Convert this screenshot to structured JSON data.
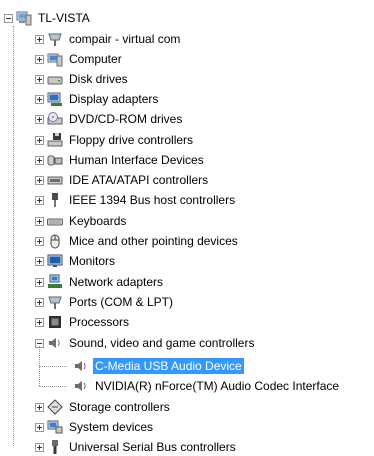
{
  "tree": {
    "root": {
      "label": "TL-VISTA",
      "icon": "computer-icon"
    },
    "categories": [
      {
        "label": "compair - virtual com",
        "icon": "port-icon",
        "expanded": false
      },
      {
        "label": "Computer",
        "icon": "computer-icon",
        "expanded": false
      },
      {
        "label": "Disk drives",
        "icon": "disk-drive-icon",
        "expanded": false
      },
      {
        "label": "Display adapters",
        "icon": "display-adapter-icon",
        "expanded": false
      },
      {
        "label": "DVD/CD-ROM drives",
        "icon": "dvd-drive-icon",
        "expanded": false
      },
      {
        "label": "Floppy drive controllers",
        "icon": "floppy-controller-icon",
        "expanded": false
      },
      {
        "label": "Human Interface Devices",
        "icon": "hid-icon",
        "expanded": false
      },
      {
        "label": "IDE ATA/ATAPI controllers",
        "icon": "ide-controller-icon",
        "expanded": false
      },
      {
        "label": "IEEE 1394 Bus host controllers",
        "icon": "ieee1394-icon",
        "expanded": false
      },
      {
        "label": "Keyboards",
        "icon": "keyboard-icon",
        "expanded": false
      },
      {
        "label": "Mice and other pointing devices",
        "icon": "mouse-icon",
        "expanded": false
      },
      {
        "label": "Monitors",
        "icon": "monitor-icon",
        "expanded": false
      },
      {
        "label": "Network adapters",
        "icon": "network-adapter-icon",
        "expanded": false
      },
      {
        "label": "Ports (COM & LPT)",
        "icon": "port-icon",
        "expanded": false
      },
      {
        "label": "Processors",
        "icon": "processor-icon",
        "expanded": false
      },
      {
        "label": "Sound, video and game controllers",
        "icon": "speaker-icon",
        "expanded": true,
        "children": [
          {
            "label": "C-Media USB Audio Device",
            "icon": "speaker-icon",
            "selected": true
          },
          {
            "label": "NVIDIA(R) nForce(TM) Audio Codec Interface",
            "icon": "speaker-icon",
            "selected": false
          }
        ]
      },
      {
        "label": "Storage controllers",
        "icon": "storage-controller-icon",
        "expanded": false
      },
      {
        "label": "System devices",
        "icon": "system-devices-icon",
        "expanded": false
      },
      {
        "label": "Universal Serial Bus controllers",
        "icon": "usb-icon",
        "expanded": false
      }
    ]
  },
  "colors": {
    "selection": "#3399ff",
    "tree_lines": "#9a9a9a"
  }
}
